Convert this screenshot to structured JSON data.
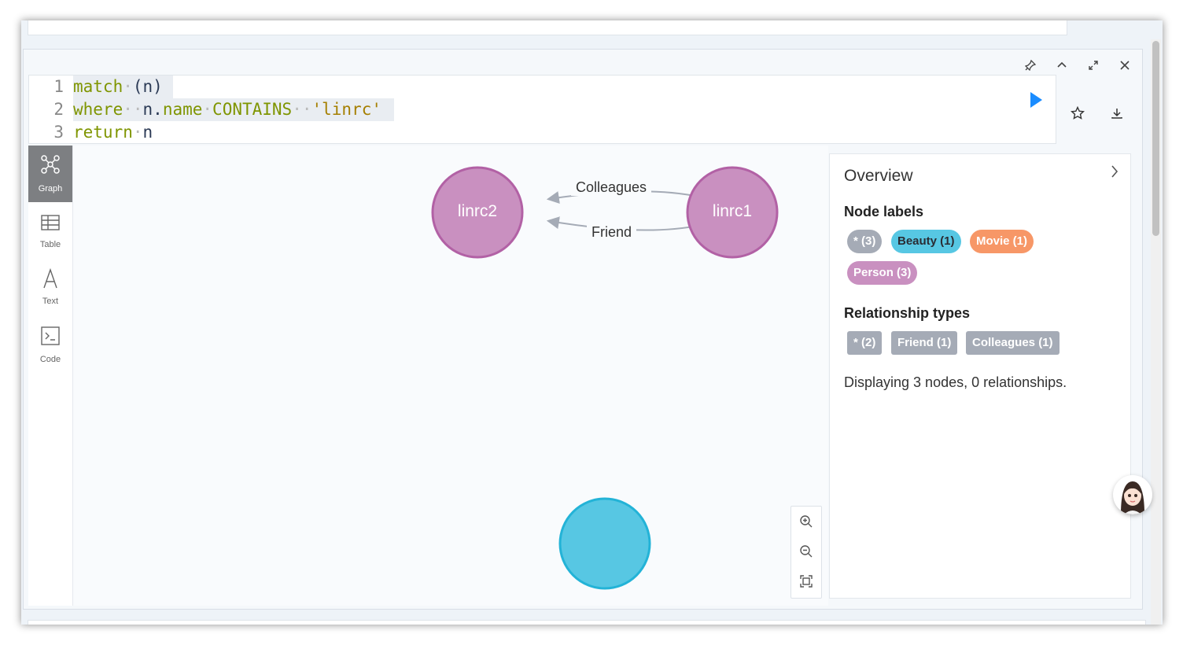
{
  "editor": {
    "lines": [
      {
        "num": "1",
        "text": "match (n)"
      },
      {
        "num": "2",
        "text": "where n.name CONTAINS 'linrc'"
      },
      {
        "num": "3",
        "text": "return n"
      }
    ],
    "tokens": {
      "l1_kw": "match",
      "l1_rest": "(n)",
      "l2_kw": "where",
      "l2_obj": "n.",
      "l2_prop": "name",
      "l2_op": "CONTAINS",
      "l2_str": "'linrc'",
      "l3_kw": "return",
      "l3_rest": "n"
    }
  },
  "frame_controls": [
    "pin-icon",
    "chevron-up-icon",
    "expand-icon",
    "close-icon"
  ],
  "side_actions": [
    "play-icon",
    "star-icon",
    "download-icon"
  ],
  "nav": {
    "items": [
      {
        "label": "Graph",
        "icon": "graph-icon",
        "active": true
      },
      {
        "label": "Table",
        "icon": "table-icon",
        "active": false
      },
      {
        "label": "Text",
        "icon": "text-icon",
        "active": false
      },
      {
        "label": "Code",
        "icon": "code-icon",
        "active": false
      }
    ]
  },
  "graph": {
    "nodes": [
      {
        "label": "linrc2",
        "color": "#c990c0"
      },
      {
        "label": "linrc1",
        "color": "#c990c0"
      },
      {
        "label": "",
        "color": "#57c7e3"
      }
    ],
    "relationships": [
      {
        "label": "Colleagues",
        "from": "linrc1",
        "to": "linrc2"
      },
      {
        "label": "Friend",
        "from": "linrc1",
        "to": "linrc2"
      }
    ]
  },
  "overview": {
    "title": "Overview",
    "node_labels_heading": "Node labels",
    "node_labels": [
      {
        "text": "* (3)",
        "color": "#a5abb6"
      },
      {
        "text": "Beauty (1)",
        "color": "#57c7e3"
      },
      {
        "text": "Movie (1)",
        "color": "#f79767"
      },
      {
        "text": "Person (3)",
        "color": "#c990c0"
      }
    ],
    "relationship_types_heading": "Relationship types",
    "relationship_types": [
      {
        "text": "* (2)",
        "color": "#a5abb6"
      },
      {
        "text": "Friend (1)",
        "color": "#a5abb6"
      },
      {
        "text": "Colleagues (1)",
        "color": "#a5abb6"
      }
    ],
    "status": "Displaying 3 nodes, 0 relationships."
  },
  "zoom": [
    "zoom-in-icon",
    "zoom-out-icon",
    "fit-icon"
  ]
}
